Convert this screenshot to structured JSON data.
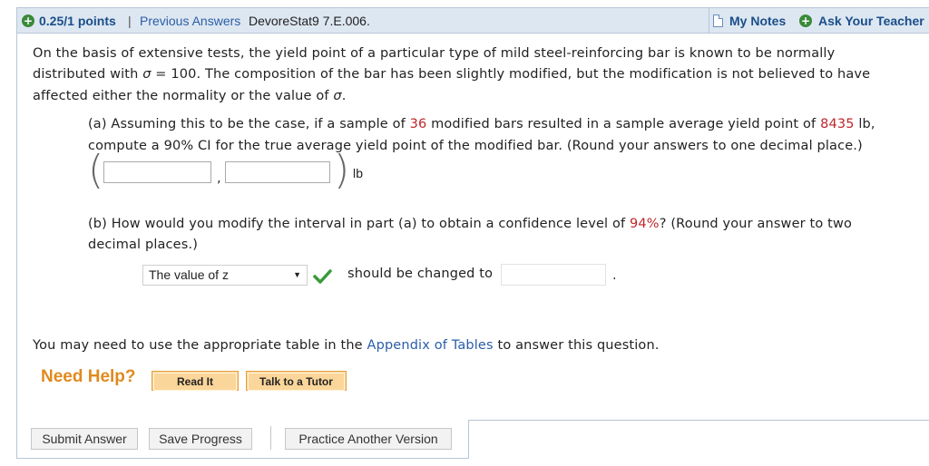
{
  "header": {
    "points": "0.25/1 points",
    "separator": "|",
    "previous_answers": "Previous Answers",
    "assignment_id": "DevoreStat9 7.E.006.",
    "my_notes": "My Notes",
    "ask_teacher": "Ask Your Teacher"
  },
  "problem": {
    "intro": {
      "l1": "On the basis of extensive tests, the yield point of a particular type of mild steel-reinforcing bar is known to be normally",
      "l2a": "distributed with ",
      "sigma": "σ",
      "l2b": " = 100. The composition of the bar has been slightly modified, but the modification is not believed to have",
      "l3a": "affected either the normality or the value of ",
      "l3b": "."
    },
    "part_a": {
      "l1a": "(a) Assuming this to be the case, if a sample of ",
      "n": "36",
      "l1b": " modified bars resulted in a sample average yield point of ",
      "xbar": "8435",
      "l1c": " lb,",
      "l2": "compute a 90% CI for the true average yield point of the modified bar. (Round your answers to one decimal place.)",
      "open_paren": "(",
      "comma": ",",
      "close_paren": ")",
      "unit": "lb",
      "lower_value": "",
      "upper_value": ""
    },
    "part_b": {
      "l1a": "(b) How would you modify the interval in part (a) to obtain a confidence level of ",
      "level": "94%",
      "l1b": "? (Round your answer to two",
      "l2": "decimal places.)",
      "select_value": "The value of z",
      "select_arrow": "▼",
      "should_change": "should be changed to",
      "answer_value": "",
      "period": "."
    },
    "appendix": {
      "pre": "You may need to use the appropriate table in the ",
      "link": "Appendix of Tables",
      "post": " to answer this question."
    }
  },
  "help": {
    "label": "Need Help?",
    "read_it": "Read It",
    "talk_to_tutor": "Talk to a Tutor"
  },
  "footer": {
    "submit": "Submit Answer",
    "save": "Save Progress",
    "practice": "Practice Another Version"
  },
  "colors": {
    "accent_blue": "#2a5ea8",
    "header_bg": "#dde7f1",
    "highlight_red": "#c0262c",
    "help_orange": "#e08a1e",
    "check_green": "#3a9a3a"
  }
}
